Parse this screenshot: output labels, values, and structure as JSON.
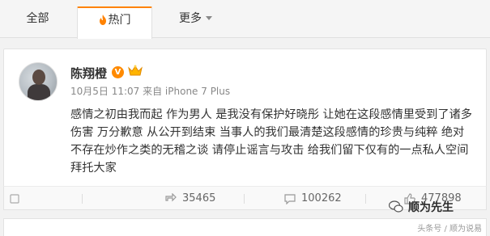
{
  "tabs": [
    {
      "label": "全部",
      "icon": ""
    },
    {
      "label": "热门",
      "icon": "flame-icon",
      "active": true
    },
    {
      "label": "更多",
      "icon": "chevron-down-icon"
    }
  ],
  "post": {
    "author": "陈翔橙",
    "verified_badge": "V",
    "meta": "10月5日 11:07 来自 iPhone 7 Plus",
    "content": "感情之初由我而起 作为男人 是我没有保护好晓彤 让她在这段感情里受到了诸多伤害 万分歉意 从公开到结束 当事人的我们最清楚这段感情的珍贵与纯粹 绝对不存在炒作之类的无稽之谈 请停止谣言与攻击 给我们留下仅有的一点私人空间 拜托大家",
    "actions": {
      "repost_count": "35465",
      "comment_count": "100262",
      "like_count": "477898"
    }
  },
  "watermark": {
    "label": "顺为先生",
    "source": "头条号 / 顺为说易"
  },
  "colors": {
    "accent": "#ff8200",
    "badge": "#ff8a00"
  }
}
